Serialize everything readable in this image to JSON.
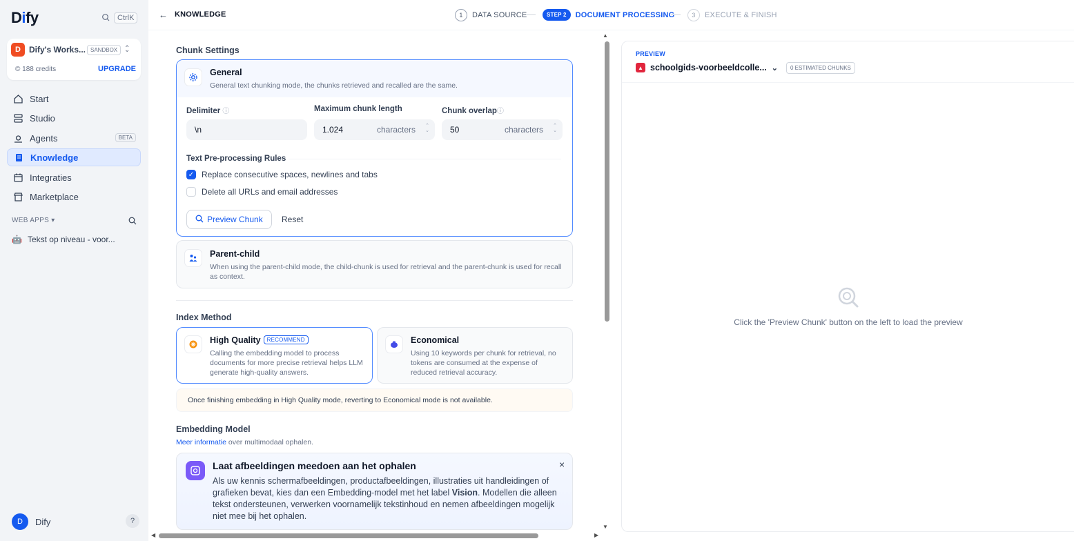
{
  "app": {
    "logo_pre": "D",
    "logo_i": "i",
    "logo_post": "fy",
    "search_kbd": "Ctrl",
    "search_key": "K"
  },
  "workspace": {
    "avatar": "D",
    "name": "Dify's Works...",
    "plan": "SANDBOX",
    "credits": "188 credits",
    "upgrade": "UPGRADE"
  },
  "nav": [
    {
      "label": "Start",
      "icon": "home-icon"
    },
    {
      "label": "Studio",
      "icon": "studio-icon"
    },
    {
      "label": "Agents",
      "icon": "agent-icon",
      "badge": "BETA"
    },
    {
      "label": "Knowledge",
      "icon": "book-icon",
      "active": true
    },
    {
      "label": "Integraties",
      "icon": "calendar-icon"
    },
    {
      "label": "Marketplace",
      "icon": "store-icon"
    }
  ],
  "webapps": {
    "label": "WEB APPS",
    "items": [
      {
        "emoji": "🤖",
        "label": "Tekst op niveau - voor..."
      }
    ]
  },
  "user": {
    "avatar": "D",
    "name": "Dify",
    "help": "?"
  },
  "header": {
    "back": "←",
    "title": "KNOWLEDGE",
    "steps": [
      {
        "num": "1",
        "label": "DATA SOURCE"
      },
      {
        "num": "STEP 2",
        "label": "DOCUMENT PROCESSING"
      },
      {
        "num": "3",
        "label": "EXECUTE & FINISH"
      }
    ]
  },
  "chunk": {
    "title": "Chunk Settings",
    "general": {
      "title": "General",
      "desc": "General text chunking mode, the chunks retrieved and recalled are the same."
    },
    "delimiter": {
      "label": "Delimiter",
      "value": "\\n"
    },
    "max_len": {
      "label": "Maximum chunk length",
      "value": "1.024",
      "unit": "characters"
    },
    "overlap": {
      "label": "Chunk overlap",
      "value": "50",
      "unit": "characters"
    },
    "rules_title": "Text Pre-processing Rules",
    "rules": [
      {
        "label": "Replace consecutive spaces, newlines and tabs",
        "checked": true
      },
      {
        "label": "Delete all URLs and email addresses",
        "checked": false
      }
    ],
    "preview_btn": "Preview Chunk",
    "reset_btn": "Reset",
    "parent_child": {
      "title": "Parent-child",
      "desc": "When using the parent-child mode, the child-chunk is used for retrieval and the parent-chunk is used for recall as context."
    }
  },
  "index": {
    "title": "Index Method",
    "high": {
      "title": "High Quality",
      "badge": "RECOMMEND",
      "desc": "Calling the embedding model to process documents for more precise retrieval helps LLM generate high-quality answers."
    },
    "eco": {
      "title": "Economical",
      "desc": "Using 10 keywords per chunk for retrieval, no tokens are consumed at the expense of reduced retrieval accuracy."
    },
    "warning": "Once finishing embedding in High Quality mode, reverting to Economical mode is not available."
  },
  "embedding": {
    "title": "Embedding Model",
    "link": "Meer informatie",
    "link_rest": " over multimodaal ophalen.",
    "info_title": "Laat afbeeldingen meedoen aan het ophalen",
    "info_text_1": "Als uw kennis schermafbeeldingen, productafbeeldingen, illustraties uit handleidingen of grafieken bevat, kies dan een Embedding-model met het label ",
    "info_bold": "Vision",
    "info_text_2": ". Modellen die alleen tekst ondersteunen, verwerken voornamelijk tekstinhoud en nemen afbeeldingen mogelijk niet mee bij het ophalen."
  },
  "preview": {
    "label": "PREVIEW",
    "file": "schoolgids-voorbeeldcolle...",
    "count": "0 ESTIMATED CHUNKS",
    "empty": "Click the 'Preview Chunk' button on the left to load the preview"
  },
  "colors": {
    "accent": "#155aef",
    "sidebar_bg": "#f2f4f7",
    "active_nav_bg": "#e0eaff"
  }
}
